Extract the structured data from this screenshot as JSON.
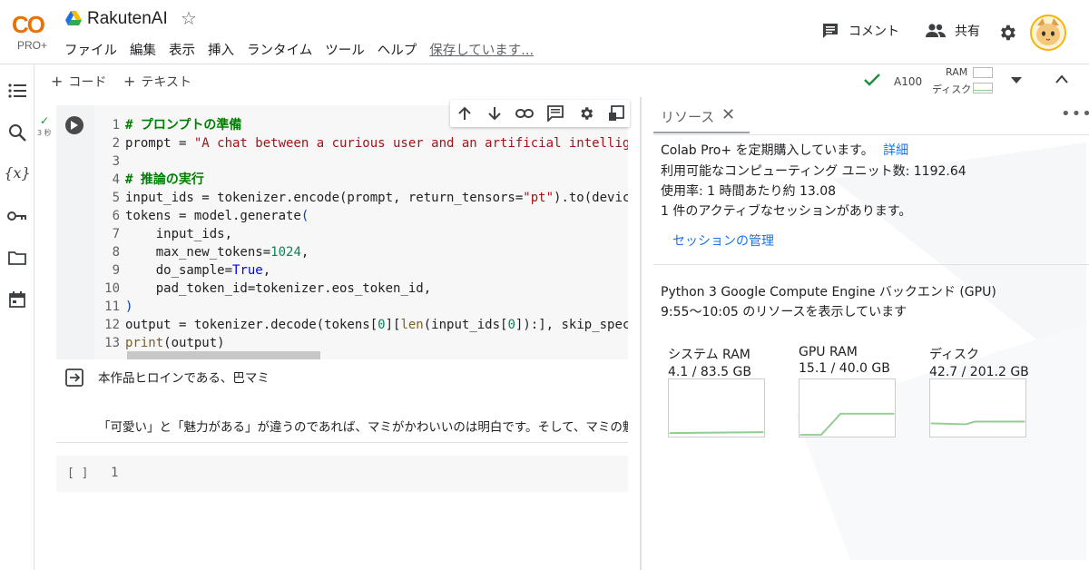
{
  "app": {
    "logo_text": "CO",
    "logo_sub": "PRO+",
    "title": "RakutenAI",
    "menu": [
      "ファイル",
      "編集",
      "表示",
      "挿入",
      "ランタイム",
      "ツール",
      "ヘルプ"
    ],
    "saving_status": "保存しています..."
  },
  "header": {
    "comment_label": "コメント",
    "share_label": "共有"
  },
  "toolbar": {
    "add_code": "コード",
    "add_text": "テキスト",
    "runtime": "A100",
    "ram_label": "RAM",
    "disk_label": "ディスク"
  },
  "cell": {
    "exec_time": "3 秒",
    "line_numbers": [
      "1",
      "2",
      "3",
      "4",
      "5",
      "6",
      "7",
      "8",
      "9",
      "10",
      "11",
      "12",
      "13"
    ],
    "output_line1": "本作品ヒロインである、巴マミ",
    "output_line2": "「可愛い」と「魅力がある」が違うのであれば、マミがかわいいのは明白です。そして、マミの魅力に"
  },
  "cell2": {
    "brackets": "[ ]",
    "line_number": "1"
  },
  "panel": {
    "tab_label": "リソース",
    "subscription": "Colab Pro+ を定期購入しています。",
    "details_link": "詳細",
    "units": "利用可能なコンピューティング ユニット数: 1192.64",
    "rate": "使用率: 1 時間あたり約 13.08",
    "sessions": "1 件のアクティブなセッションがあります。",
    "manage_link": "セッションの管理",
    "backend": "Python 3 Google Compute Engine バックエンド (GPU)",
    "range": "9:55〜10:05 のリソースを表示しています",
    "gauges": [
      {
        "title": "システム RAM",
        "value": "4.1 / 83.5 GB"
      },
      {
        "title": "GPU RAM",
        "value": "15.1 / 40.0 GB"
      },
      {
        "title": "ディスク",
        "value": "42.7 / 201.2 GB"
      }
    ]
  },
  "colors": {
    "accent": "#1a73e8",
    "success": "#1e8e3e",
    "logo_orange": "#f9ab00",
    "chart_line": "#8fce8f"
  }
}
